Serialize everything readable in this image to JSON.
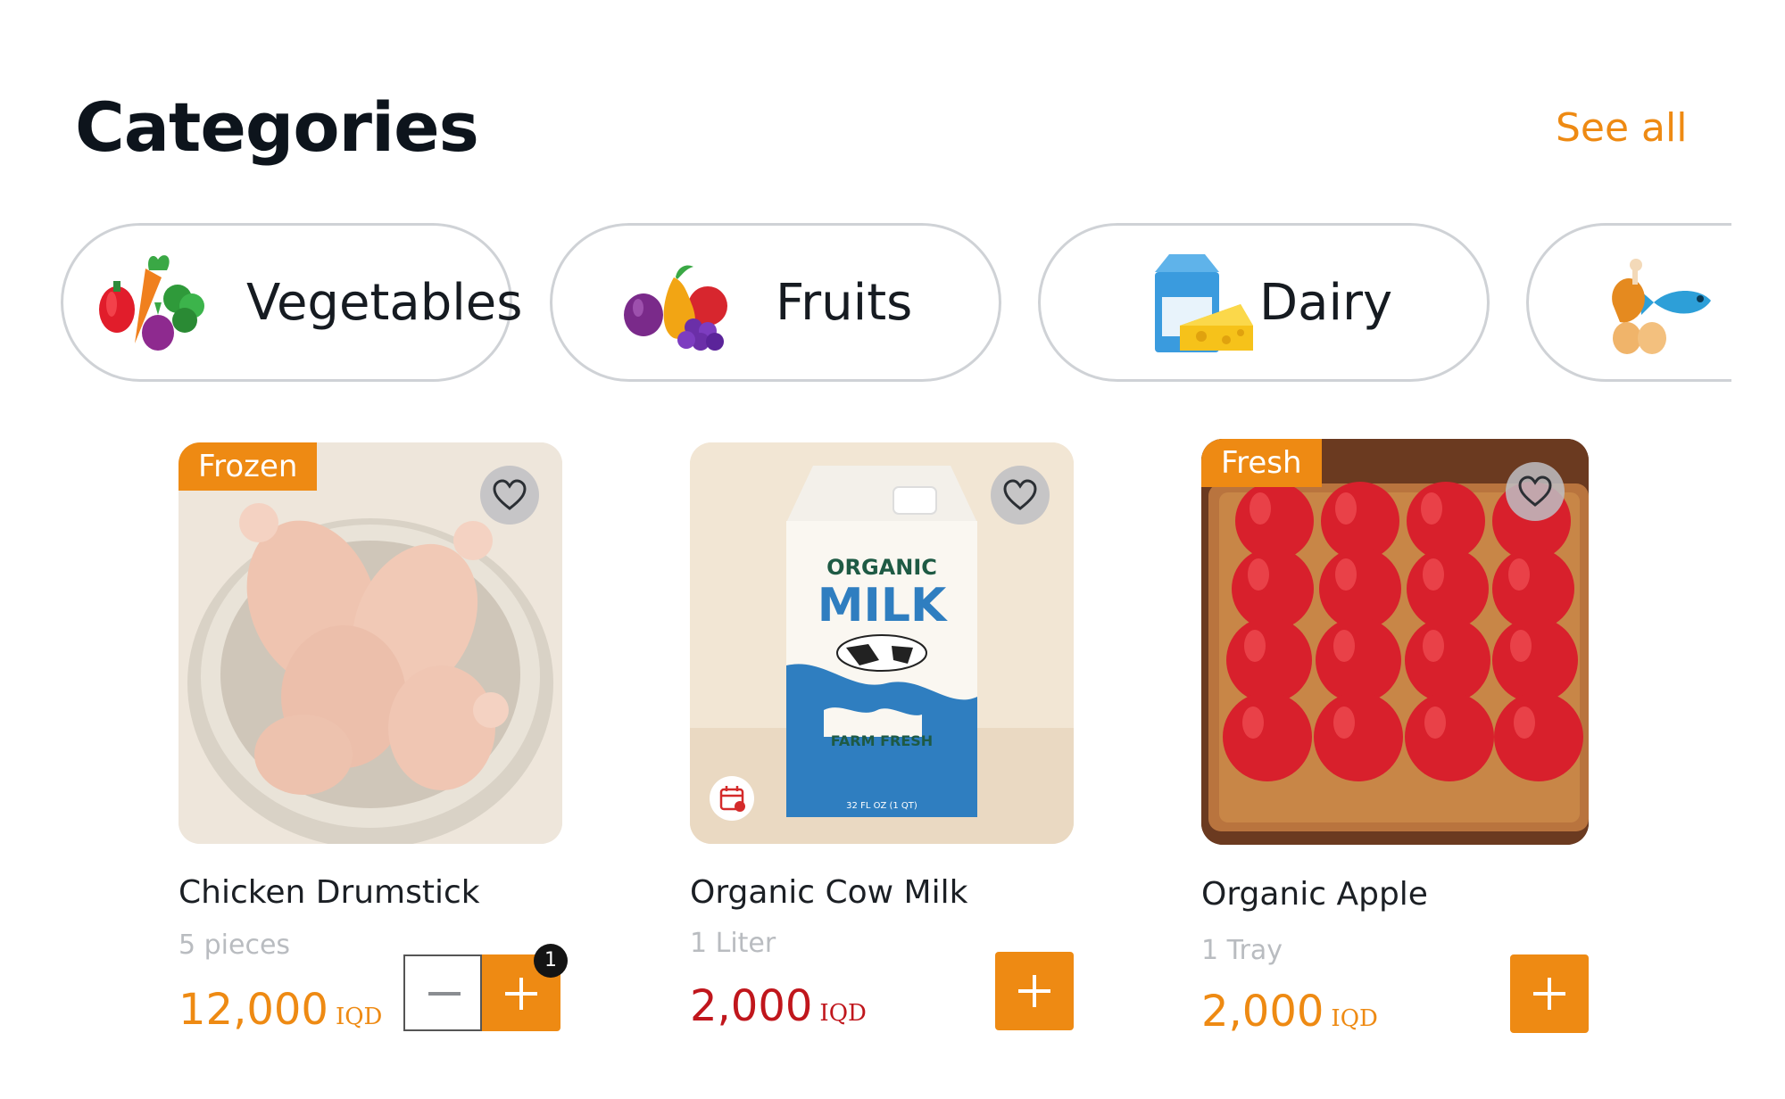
{
  "header": {
    "title": "Categories",
    "see_all": "See all"
  },
  "categories": [
    {
      "label": "Vegetables",
      "icon": "vegetables-icon"
    },
    {
      "label": "Fruits",
      "icon": "fruits-icon"
    },
    {
      "label": "Dairy",
      "icon": "dairy-icon"
    },
    {
      "label": "",
      "icon": "meat-fish-icon"
    }
  ],
  "products": [
    {
      "badge": "Frozen",
      "name": "Chicken Drumstick",
      "unit": "5 pieces",
      "price": "12,000",
      "currency": "IQD",
      "cart_count": "1",
      "price_color": "#ee8a13"
    },
    {
      "badge": "",
      "name": "Organic Cow Milk",
      "unit": "1 Liter",
      "price": "2,000",
      "currency": "IQD",
      "price_color": "#c0161c",
      "image_text": {
        "line1": "ORGANIC",
        "line2": "MILK",
        "line3": "FARM FRESH",
        "line4": "32 FL OZ (1 QT)"
      }
    },
    {
      "badge": "Fresh",
      "name": "Organic Apple",
      "unit": "1 Tray",
      "price": "2,000",
      "currency": "IQD",
      "price_color": "#ee8a13"
    }
  ],
  "colors": {
    "accent": "#ee8a13",
    "sale_price": "#c0161c",
    "pill_border": "#cfd2d6"
  }
}
